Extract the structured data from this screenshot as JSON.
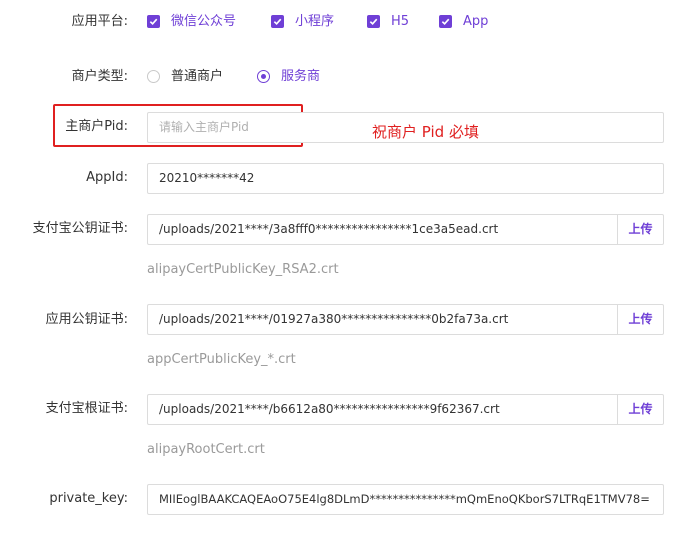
{
  "platform": {
    "label": "应用平台:",
    "options": [
      "微信公众号",
      "小程序",
      "H5",
      "App"
    ]
  },
  "merchant_type": {
    "label": "商户类型:",
    "options": [
      "普通商户",
      "服务商"
    ],
    "selected": "服务商"
  },
  "main_pid": {
    "label": "主商户Pid:",
    "placeholder": "请输入主商户Pid",
    "annotation": "祝商户 Pid 必填"
  },
  "appid": {
    "label": "AppId:",
    "value": "20210*******42"
  },
  "alipay_public_cert": {
    "label": "支付宝公钥证书:",
    "value": "/uploads/2021****/3a8fff0****************1ce3a5ead.crt",
    "upload": "上传",
    "hint": "alipayCertPublicKey_RSA2.crt"
  },
  "app_public_cert": {
    "label": "应用公钥证书:",
    "value": "/uploads/2021****/01927a380***************0b2fa73a.crt",
    "upload": "上传",
    "hint": "appCertPublicKey_*.crt"
  },
  "alipay_root_cert": {
    "label": "支付宝根证书:",
    "value": "/uploads/2021****/b6612a80****************9f62367.crt",
    "upload": "上传",
    "hint": "alipayRootCert.crt"
  },
  "private_key": {
    "label": "private_key:",
    "value": "MIIEoglBAAKCAQEAoO75E4lg8DLmD***************mQmEnoQKborS7LTRqE1TMV78="
  },
  "colors": {
    "accent": "#6f3fd6",
    "annotation": "#e02020"
  }
}
